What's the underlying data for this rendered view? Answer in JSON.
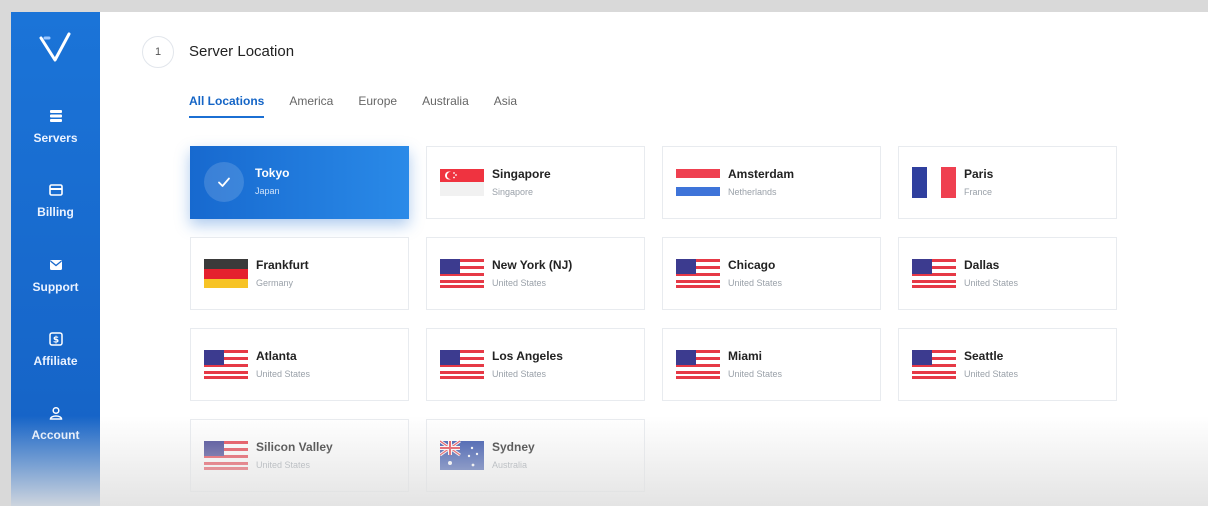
{
  "sidebar": {
    "logo_icon": "v-logo-icon",
    "items": [
      {
        "label": "Servers",
        "icon": "servers-icon"
      },
      {
        "label": "Billing",
        "icon": "credit-card-icon"
      },
      {
        "label": "Support",
        "icon": "mail-icon"
      },
      {
        "label": "Affiliate",
        "icon": "dollar-icon"
      },
      {
        "label": "Account",
        "icon": "user-icon"
      }
    ]
  },
  "header": {
    "step_number": "1",
    "title": "Server Location"
  },
  "tabs": [
    {
      "label": "All Locations",
      "active": true
    },
    {
      "label": "America",
      "active": false
    },
    {
      "label": "Europe",
      "active": false
    },
    {
      "label": "Australia",
      "active": false
    },
    {
      "label": "Asia",
      "active": false
    }
  ],
  "locations": [
    {
      "city": "Tokyo",
      "country": "Japan",
      "flag": "check-icon",
      "selected": true
    },
    {
      "city": "Singapore",
      "country": "Singapore",
      "flag": "singapore-flag-icon",
      "selected": false
    },
    {
      "city": "Amsterdam",
      "country": "Netherlands",
      "flag": "netherlands-flag-icon",
      "selected": false
    },
    {
      "city": "Paris",
      "country": "France",
      "flag": "france-flag-icon",
      "selected": false
    },
    {
      "city": "Frankfurt",
      "country": "Germany",
      "flag": "germany-flag-icon",
      "selected": false
    },
    {
      "city": "New York (NJ)",
      "country": "United States",
      "flag": "usa-flag-icon",
      "selected": false
    },
    {
      "city": "Chicago",
      "country": "United States",
      "flag": "usa-flag-icon",
      "selected": false
    },
    {
      "city": "Dallas",
      "country": "United States",
      "flag": "usa-flag-icon",
      "selected": false
    },
    {
      "city": "Atlanta",
      "country": "United States",
      "flag": "usa-flag-icon",
      "selected": false
    },
    {
      "city": "Los Angeles",
      "country": "United States",
      "flag": "usa-flag-icon",
      "selected": false
    },
    {
      "city": "Miami",
      "country": "United States",
      "flag": "usa-flag-icon",
      "selected": false
    },
    {
      "city": "Seattle",
      "country": "United States",
      "flag": "usa-flag-icon",
      "selected": false
    },
    {
      "city": "Silicon Valley",
      "country": "United States",
      "flag": "usa-flag-icon",
      "selected": false
    },
    {
      "city": "Sydney",
      "country": "Australia",
      "flag": "australia-flag-icon",
      "selected": false
    }
  ],
  "colors": {
    "accent": "#1b6fd3",
    "sidebar": "#1868cc"
  }
}
